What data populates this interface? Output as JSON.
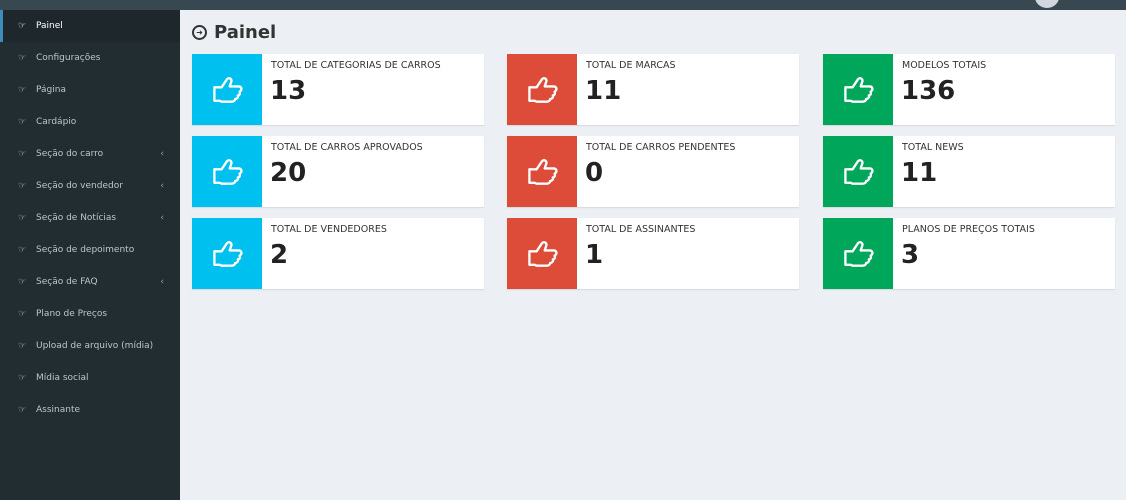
{
  "sidebar": {
    "items": [
      {
        "label": "Painel",
        "icon": "hand-point-right-icon",
        "has_submenu": false,
        "active": true
      },
      {
        "label": "Configurações",
        "icon": "hand-point-right-icon",
        "has_submenu": false
      },
      {
        "label": "Página",
        "icon": "hand-point-right-icon",
        "has_submenu": false
      },
      {
        "label": "Cardápio",
        "icon": "hand-point-right-icon",
        "has_submenu": false
      },
      {
        "label": "Seção do carro",
        "icon": "hand-point-right-icon",
        "has_submenu": true
      },
      {
        "label": "Seção do vendedor",
        "icon": "hand-point-right-icon",
        "has_submenu": true
      },
      {
        "label": "Seção de Notícias",
        "icon": "hand-point-right-icon",
        "has_submenu": true
      },
      {
        "label": "Seção de depoimento",
        "icon": "hand-point-right-icon",
        "has_submenu": false
      },
      {
        "label": "Seção de FAQ",
        "icon": "hand-point-right-icon",
        "has_submenu": true
      },
      {
        "label": "Plano de Preços",
        "icon": "hand-point-right-icon",
        "has_submenu": false
      },
      {
        "label": "Upload de arquivo (mídia)",
        "icon": "hand-point-right-icon",
        "has_submenu": false
      },
      {
        "label": "Mídia social",
        "icon": "hand-point-right-icon",
        "has_submenu": false
      },
      {
        "label": "Assinante",
        "icon": "hand-point-right-icon",
        "has_submenu": false
      }
    ]
  },
  "main": {
    "title": "Painel",
    "title_icon": "circle-arrow-right-icon",
    "boxes": [
      {
        "label": "TOTAL DE CATEGORIAS DE CARROS",
        "value": "13",
        "color": "#00c0ef",
        "icon": "thumbs-up-hand-icon"
      },
      {
        "label": "TOTAL DE MARCAS",
        "value": "11",
        "color": "#dd4b39",
        "icon": "thumbs-up-hand-icon"
      },
      {
        "label": "MODELOS TOTAIS",
        "value": "136",
        "color": "#00a65a",
        "icon": "thumbs-up-hand-icon"
      },
      {
        "label": "TOTAL DE CARROS APROVADOS",
        "value": "20",
        "color": "#00c0ef",
        "icon": "thumbs-up-hand-icon"
      },
      {
        "label": "TOTAL DE CARROS PENDENTES",
        "value": "0",
        "color": "#dd4b39",
        "icon": "thumbs-up-hand-icon"
      },
      {
        "label": "TOTAL NEWS",
        "value": "11",
        "color": "#00a65a",
        "icon": "thumbs-up-hand-icon"
      },
      {
        "label": "TOTAL DE VENDEDORES",
        "value": "2",
        "color": "#00c0ef",
        "icon": "thumbs-up-hand-icon"
      },
      {
        "label": "TOTAL DE ASSINANTES",
        "value": "1",
        "color": "#dd4b39",
        "icon": "thumbs-up-hand-icon"
      },
      {
        "label": "PLANOS DE PREÇOS TOTAIS",
        "value": "3",
        "color": "#00a65a",
        "icon": "thumbs-up-hand-icon"
      }
    ]
  },
  "colors": {
    "sidebar_bg": "#222d32",
    "content_bg": "#ecf0f5",
    "aqua": "#00c0ef",
    "red": "#dd4b39",
    "green": "#00a65a"
  }
}
